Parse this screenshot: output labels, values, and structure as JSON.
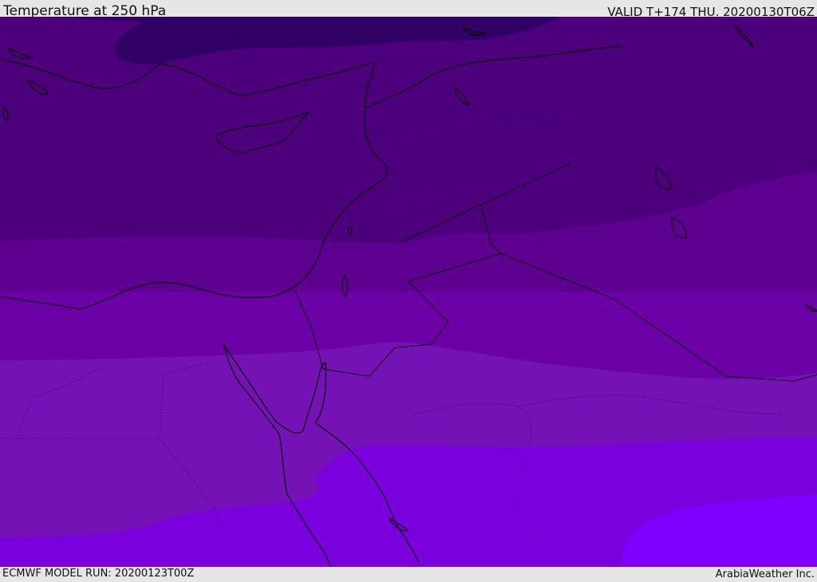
{
  "header": {
    "title": "Temperature at 250 hPa",
    "valid": "VALID T+174 THU. 20200130T06Z"
  },
  "footer": {
    "model_run": "ECMWF MODEL RUN: 20200123T00Z",
    "credit": "ArabiaWeather Inc."
  },
  "colors": {
    "band_coldest": "#300065",
    "band_2": "#4c007c",
    "band_3": "#5d008f",
    "band_4": "#6a00a6",
    "band_5": "#7412b5",
    "band_6": "#7a00de",
    "band_warmest": "#7f00ff",
    "coastline": "#000000",
    "borders": "#1a0030"
  }
}
